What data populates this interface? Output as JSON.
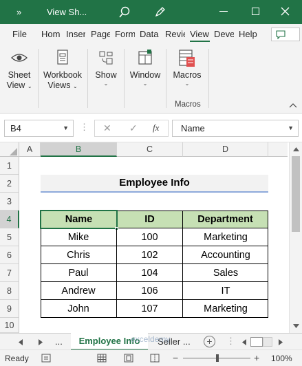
{
  "titlebar": {
    "more": "»",
    "filename": "View Sh...",
    "restore_glyph": "□",
    "minimize_glyph": "—",
    "close_glyph": "✕",
    "search_icon": "search-icon",
    "pen_icon": "pen-icon",
    "bg_color": "#217346"
  },
  "tabs": [
    "File",
    "Hom",
    "Inser",
    "Page",
    "Form",
    "Data",
    "Revie",
    "View",
    "Deve",
    "Help"
  ],
  "active_tab": "View",
  "ribbon": {
    "sheet_view": {
      "line1": "Sheet",
      "line2": "View"
    },
    "workbook_views": {
      "line1": "Workbook",
      "line2": "Views"
    },
    "show": {
      "line1": "Show"
    },
    "window": {
      "line1": "Window"
    },
    "macros": {
      "line1": "Macros",
      "group": "Macros"
    }
  },
  "formula_bar": {
    "name_box": "B4",
    "cancel": "✕",
    "enter": "✓",
    "fx": "fx",
    "formula": "Name"
  },
  "grid": {
    "columns": [
      "A",
      "B",
      "C",
      "D"
    ],
    "rows": [
      "1",
      "2",
      "3",
      "4",
      "5",
      "6",
      "7",
      "8",
      "9",
      "10"
    ],
    "title": "Employee Info",
    "headers": [
      "Name",
      "ID",
      "Department"
    ],
    "data": [
      [
        "Mike",
        "100",
        "Marketing"
      ],
      [
        "Chris",
        "102",
        "Accounting"
      ],
      [
        "Paul",
        "104",
        "Sales"
      ],
      [
        "Andrew",
        "106",
        "IT"
      ],
      [
        "John",
        "107",
        "Marketing"
      ]
    ],
    "header_fill": "#c6e0b4",
    "title_underline": "#8ea9db"
  },
  "sheet_tabs": {
    "ellipsis": "...",
    "active": "Employee Info",
    "next": "Seller ...",
    "add": "+"
  },
  "status": {
    "ready": "Ready",
    "zoom": "100%",
    "minus": "−",
    "plus": "+"
  },
  "watermark": "exceldemy EXCEL · DATA · BI"
}
